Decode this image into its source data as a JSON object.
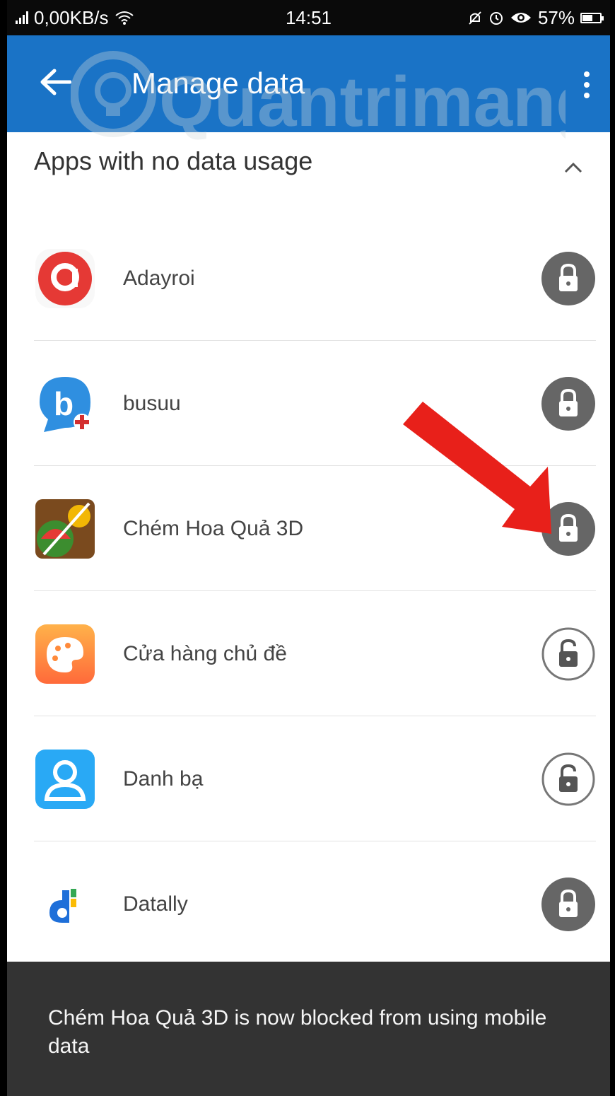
{
  "status_bar": {
    "network_speed": "0,00KB/s",
    "time": "14:51",
    "battery": "57%",
    "battery_level": 0.57,
    "icons": [
      "signal-icon",
      "wifi-icon",
      "silent-icon",
      "alarm-icon",
      "eye-icon",
      "battery-icon"
    ]
  },
  "app_bar": {
    "title": "Manage data",
    "back_icon": "arrow-left-icon",
    "menu_icon": "more-vertical-icon",
    "background": "#1a73c6"
  },
  "watermark": {
    "text": "Quantrimang"
  },
  "section": {
    "title": "Apps with no data usage",
    "toggle_icon": "chevron-up-icon"
  },
  "apps": [
    {
      "name": "Adayroi",
      "icon": "adayroi-app-icon",
      "locked": true
    },
    {
      "name": "busuu",
      "icon": "busuu-app-icon",
      "locked": true
    },
    {
      "name": "Chém Hoa Quả 3D",
      "icon": "chem-hoa-qua-app-icon",
      "locked": true
    },
    {
      "name": "Cửa hàng chủ đề",
      "icon": "theme-store-app-icon",
      "locked": false
    },
    {
      "name": "Danh bạ",
      "icon": "contacts-app-icon",
      "locked": false
    },
    {
      "name": "Datally",
      "icon": "datally-app-icon",
      "locked": true
    }
  ],
  "snackbar": {
    "message": "Chém Hoa Quả 3D is now blocked from using mobile data"
  },
  "colors": {
    "locked": "#666666",
    "unlocked_border": "#777777",
    "annotation": "#e8201a"
  }
}
